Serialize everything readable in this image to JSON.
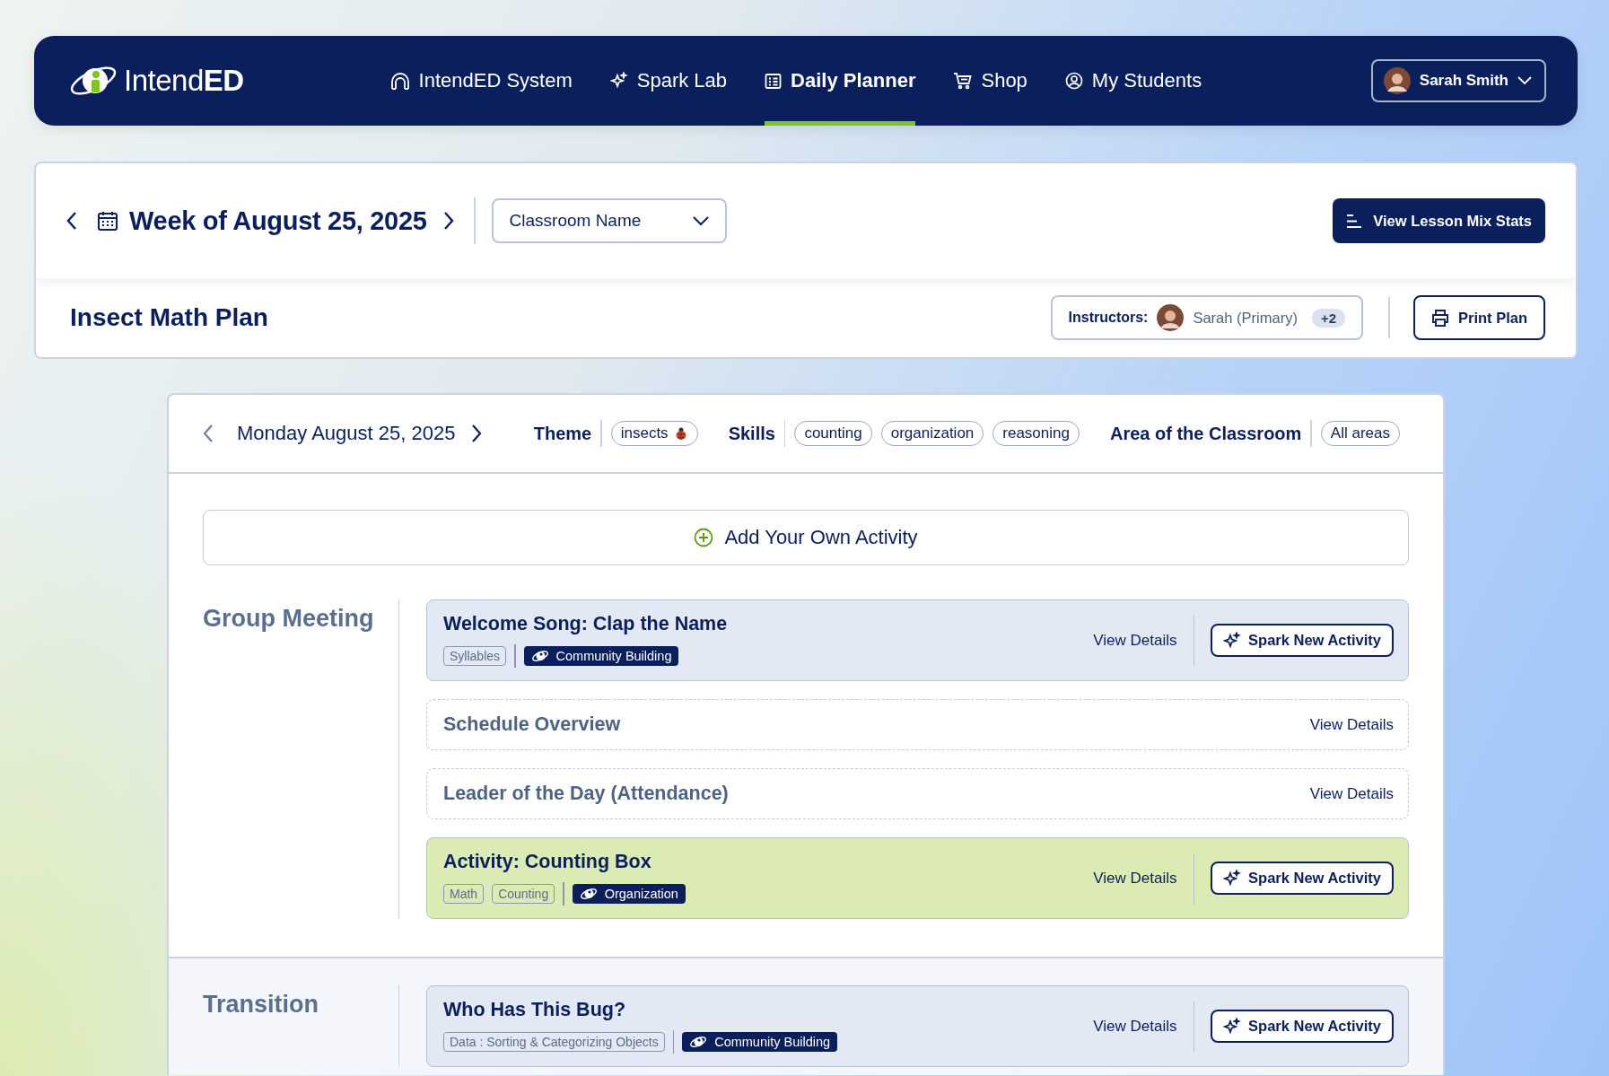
{
  "nav": {
    "logo": "Intend**ED**",
    "items": [
      {
        "label": "IntendED System",
        "selected": false
      },
      {
        "label": "Spark Lab",
        "selected": false
      },
      {
        "label": "Daily Planner",
        "selected": true
      },
      {
        "label": "Shop",
        "selected": false
      },
      {
        "label": "My Students",
        "selected": false
      }
    ],
    "user": "Sarah Smith"
  },
  "week": {
    "label": "Week of August 25, 2025",
    "classroom": "Classroom Name",
    "stats_button": "View Lesson Mix Stats"
  },
  "plan": {
    "title": "Insect Math Plan",
    "instructors_label": "Instructors:",
    "instructor": "Sarah (Primary)",
    "more": "+2",
    "print_button": "Print Plan"
  },
  "day": {
    "date": "Monday August 25, 2025",
    "filters": [
      {
        "label": "Theme",
        "kind": "theme",
        "chips": [
          "insects"
        ]
      },
      {
        "label": "Skills",
        "kind": "plain",
        "chips": [
          "counting",
          "organization",
          "reasoning"
        ]
      },
      {
        "label": "Area of the Classroom",
        "kind": "plain",
        "chips": [
          "All areas"
        ]
      }
    ]
  },
  "add_activity": "Add Your Own Activity",
  "sections": [
    {
      "name": "Group Meeting",
      "activities": [
        {
          "title": "Welcome Song: Clap the Name",
          "kind": "planned",
          "tags": [
            "Syllables"
          ],
          "category": "Community Building",
          "details": "View Details",
          "spark": "Spark New Activity"
        },
        {
          "title": "Schedule Overview",
          "kind": "routine",
          "details": "View Details"
        },
        {
          "title": "Leader of the Day (Attendance)",
          "kind": "routine",
          "details": "View Details"
        },
        {
          "title": "Activity: Counting Box",
          "kind": "highlight",
          "tags": [
            "Math",
            "Counting"
          ],
          "category": "Organization",
          "details": "View Details",
          "spark": "Spark New Activity"
        }
      ]
    },
    {
      "name": "Transition",
      "activities": [
        {
          "title": "Who Has This Bug?",
          "kind": "planned",
          "tags": [
            "Data : Sorting & Categorizing Objects"
          ],
          "category": "Community Building",
          "details": "View Details",
          "spark": "Spark New Activity"
        }
      ]
    }
  ]
}
